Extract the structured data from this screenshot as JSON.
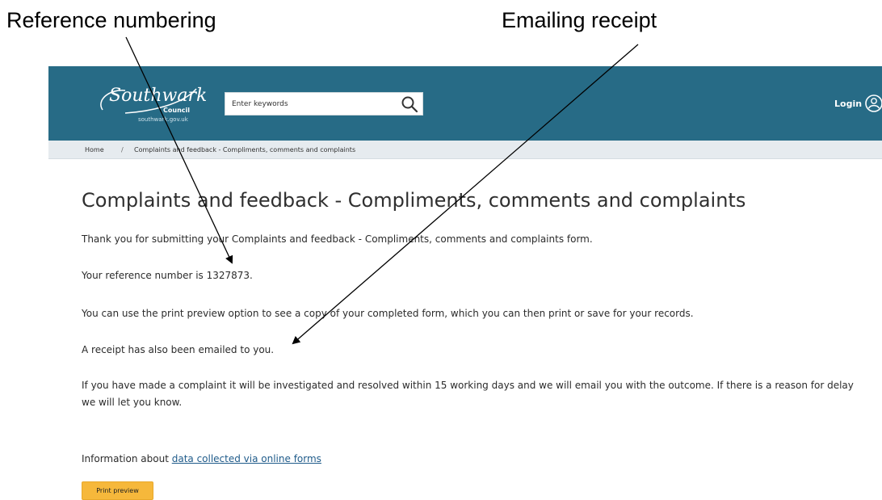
{
  "annotations": {
    "reference_label": "Reference numbering",
    "email_label": "Emailing receipt"
  },
  "header": {
    "logo_script": "Southwark",
    "logo_council": "Council",
    "logo_url": "southwark.gov.uk",
    "search_placeholder": "Enter keywords",
    "login": "Login",
    "background_color": "#276b86"
  },
  "breadcrumb": {
    "home": "Home",
    "separator": "/",
    "current": "Complaints and feedback - Compliments, comments and complaints"
  },
  "main": {
    "title": "Complaints and feedback - Compliments, comments and complaints",
    "paragraphs": [
      "Thank you for submitting your Complaints and feedback - Compliments, comments and complaints form.",
      "Your reference number is 1327873.",
      "You can use the print preview option to see a copy of your completed form, which you can then print or save for your records.",
      "A receipt has also been emailed to you.",
      "If you have made a complaint it will be investigated and resolved within 15 working days and we will email you with the outcome. If there is a reason for delay we will let you know."
    ],
    "info_prefix": "Information about ",
    "info_link": "data collected via online forms",
    "print_button": "Print preview",
    "button_color": "#f6b83b"
  },
  "icons": {
    "search": "search-icon",
    "login": "user-circle-icon",
    "logo": "southwark-logo"
  }
}
